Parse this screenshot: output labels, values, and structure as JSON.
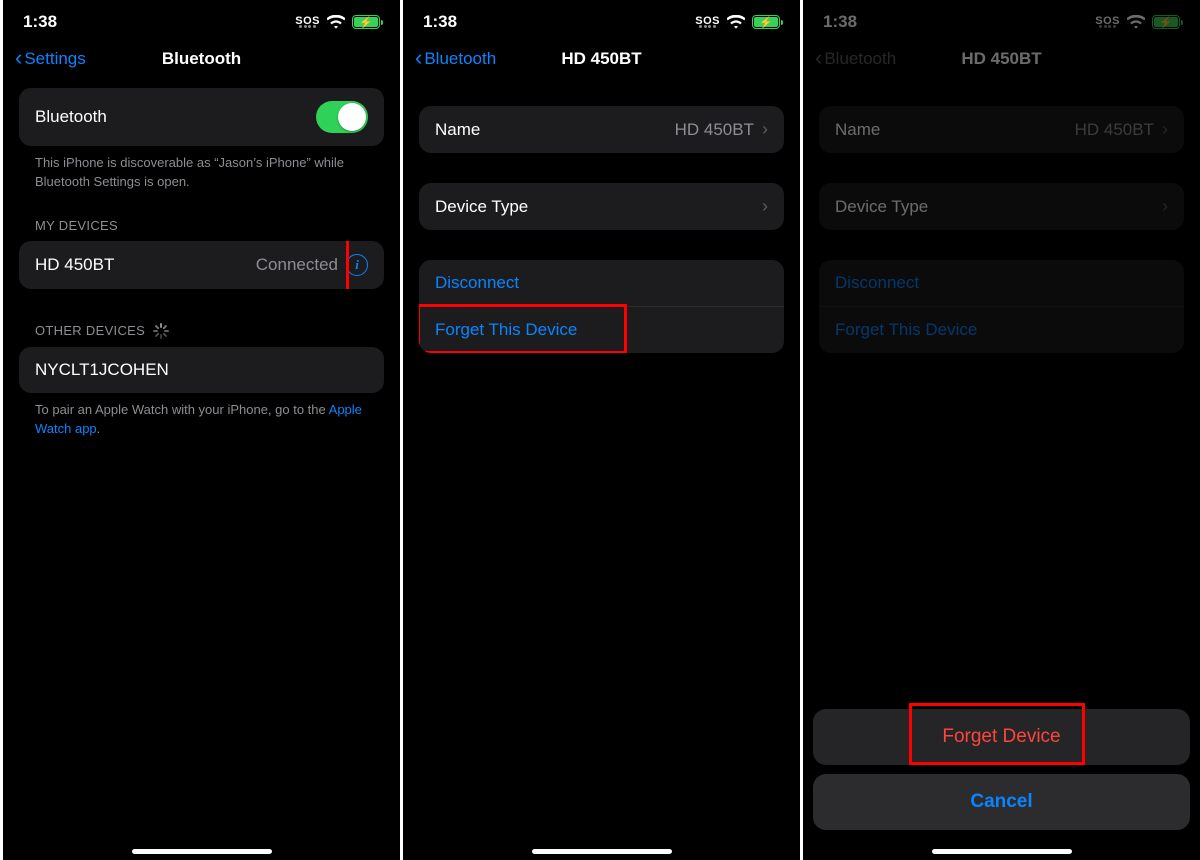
{
  "status": {
    "time": "1:38",
    "sos": "SOS"
  },
  "screen1": {
    "back": "Settings",
    "title": "Bluetooth",
    "toggleLabel": "Bluetooth",
    "discoverable": "This iPhone is discoverable as “Jason’s iPhone” while Bluetooth Settings is open.",
    "myDevices": "MY DEVICES",
    "device": "HD 450BT",
    "connected": "Connected",
    "otherDevices": "OTHER DEVICES",
    "otherDevice": "NYCLT1JCOHEN",
    "pairText": "To pair an Apple Watch with your iPhone, go to the ",
    "pairLink": "Apple Watch app",
    "pairSuffix": "."
  },
  "screen2": {
    "back": "Bluetooth",
    "title": "HD 450BT",
    "nameLabel": "Name",
    "nameValue": "HD 450BT",
    "deviceType": "Device Type",
    "disconnect": "Disconnect",
    "forget": "Forget This Device"
  },
  "screen3": {
    "back": "Bluetooth",
    "title": "HD 450BT",
    "nameLabel": "Name",
    "nameValue": "HD 450BT",
    "deviceType": "Device Type",
    "disconnect": "Disconnect",
    "forget": "Forget This Device",
    "sheetForget": "Forget Device",
    "sheetCancel": "Cancel"
  }
}
